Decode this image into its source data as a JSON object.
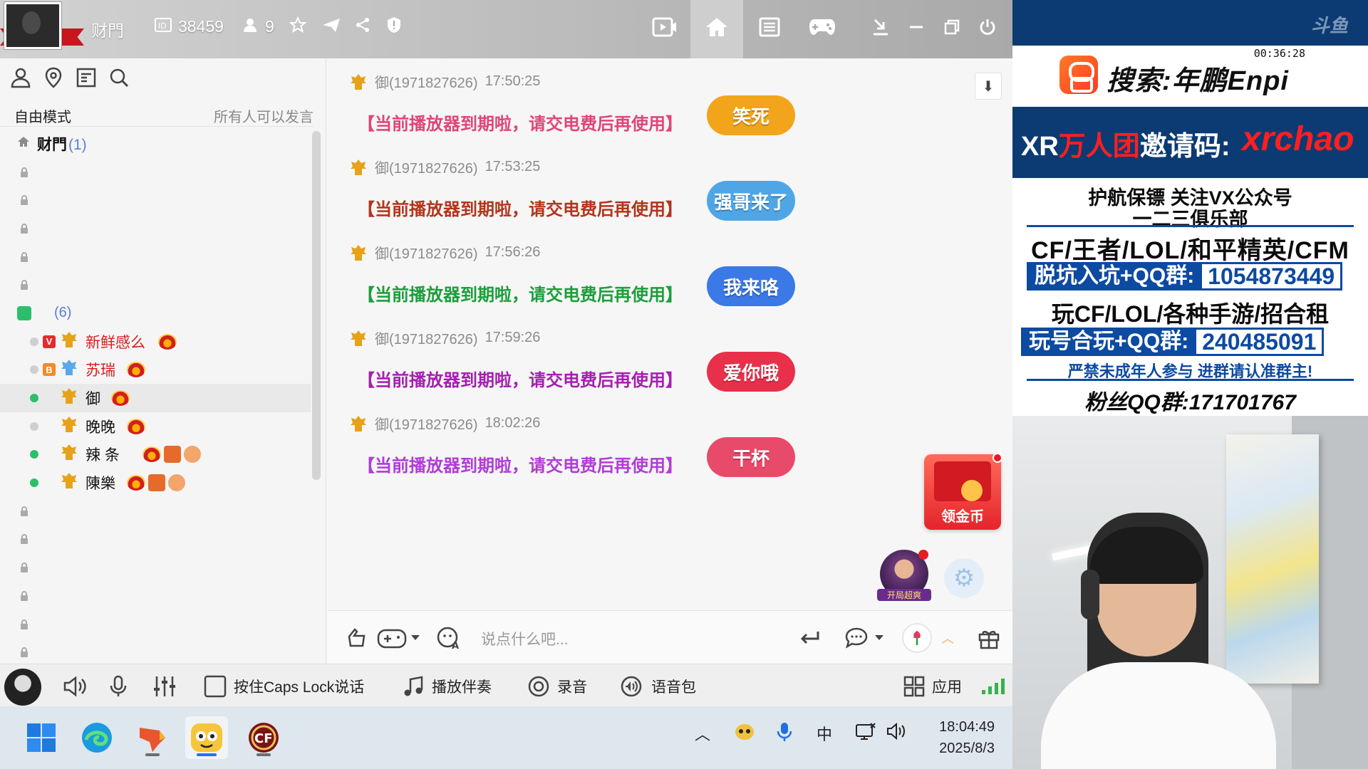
{
  "titlebar": {
    "channel_name": "财門",
    "id_label": "38459",
    "user_count": "9",
    "icons": [
      "id-icon",
      "user-icon",
      "star-icon",
      "plane-icon",
      "share-icon",
      "shield-icon",
      "video-icon",
      "home-icon",
      "list-icon",
      "gamepad-icon",
      "download-icon",
      "minimize-icon",
      "restore-icon",
      "power-icon"
    ]
  },
  "left": {
    "mode_label": "自由模式",
    "speak_label": "所有人可以发言",
    "channel": {
      "name": "财門",
      "count": "(1)"
    },
    "group_count": "(6)",
    "users": [
      {
        "name": "新鲜感么",
        "color": "#d81e1e",
        "status": "#cfcfcf",
        "badge": "V",
        "badge_color": "#e52b2b",
        "rank_color": "#e7a21a"
      },
      {
        "name": "苏瑞",
        "color": "#d81e1e",
        "status": "#cfcfcf",
        "badge": "B",
        "badge_color": "#f08a2a",
        "rank_color": "#5aa8e8"
      },
      {
        "name": "御",
        "color": "#111111",
        "status": "#2bbf6c",
        "badge": "",
        "badge_color": "",
        "rank_color": "#e7a21a"
      },
      {
        "name": "晚晚",
        "color": "#111111",
        "status": "#cfcfcf",
        "badge": "",
        "badge_color": "",
        "rank_color": "#e7a21a"
      },
      {
        "name": "辣 条",
        "color": "#111111",
        "status": "#2bbf6c",
        "badge": "",
        "badge_color": "",
        "rank_color": "#e7a21a"
      },
      {
        "name": "陳樂",
        "color": "#111111",
        "status": "#2bbf6c",
        "badge": "",
        "badge_color": "",
        "rank_color": "#e7a21a"
      }
    ]
  },
  "chat": {
    "messages": [
      {
        "sender": "御(1971827626)",
        "time": "17:50:25",
        "text": "【当前播放器到期啦，请交电费后再使用】",
        "color": "#e0457a",
        "sticker": "笑死",
        "sticker_bg": "#f2a51b"
      },
      {
        "sender": "御(1971827626)",
        "time": "17:53:25",
        "text": "【当前播放器到期啦，请交电费后再使用】",
        "color": "#b4341c",
        "sticker": "强哥来了",
        "sticker_bg": "#4fa6e6"
      },
      {
        "sender": "御(1971827626)",
        "time": "17:56:26",
        "text": "【当前播放器到期啦，请交电费后再使用】",
        "color": "#1b9e3a",
        "sticker": "我来咯",
        "sticker_bg": "#3a79e6"
      },
      {
        "sender": "御(1971827626)",
        "time": "17:59:26",
        "text": "【当前播放器到期啦，请交电费后再使用】",
        "color": "#a51fb0",
        "sticker": "爱你哦",
        "sticker_bg": "#e8304a"
      },
      {
        "sender": "御(1971827626)",
        "time": "18:02:26",
        "text": "【当前播放器到期啦，请交电费后再使用】",
        "color": "#b13bd9",
        "sticker": "干杯",
        "sticker_bg": "#e84a6a"
      }
    ],
    "redbag_label": "领金币",
    "chest_label": "开局超爽"
  },
  "input": {
    "placeholder": "说点什么吧..."
  },
  "voicebar": {
    "caps_label": "按住Caps Lock说话",
    "music_label": "播放伴奏",
    "record_label": "录音",
    "voicepack_label": "语音包",
    "apps_label": "应用"
  },
  "taskbar": {
    "time": "18:04:49",
    "date": "2025/8/3",
    "ime": "中"
  },
  "overlay": {
    "timer": "00:36:28",
    "search_text": "搜索:年鹏Enpi",
    "code_prefix": "XR",
    "code_mid": "万人团",
    "code_suffix": "邀请码:",
    "code_value": "xrchao",
    "line1": "护航保镖 关注VX公众号",
    "line2": "一二三俱乐部",
    "line3": "CF/王者/LOL/和平精英/CFM",
    "group1_label": "脱坑入坑+QQ群:",
    "group1_num": "1054873449",
    "line4": "玩CF/LOL/各种手游/招合租",
    "group2_label": "玩号合玩+QQ群:",
    "group2_num": "240485091",
    "line5": "严禁未成年人参与  进群请认准群主!",
    "line6": "粉丝QQ群:171701767"
  }
}
